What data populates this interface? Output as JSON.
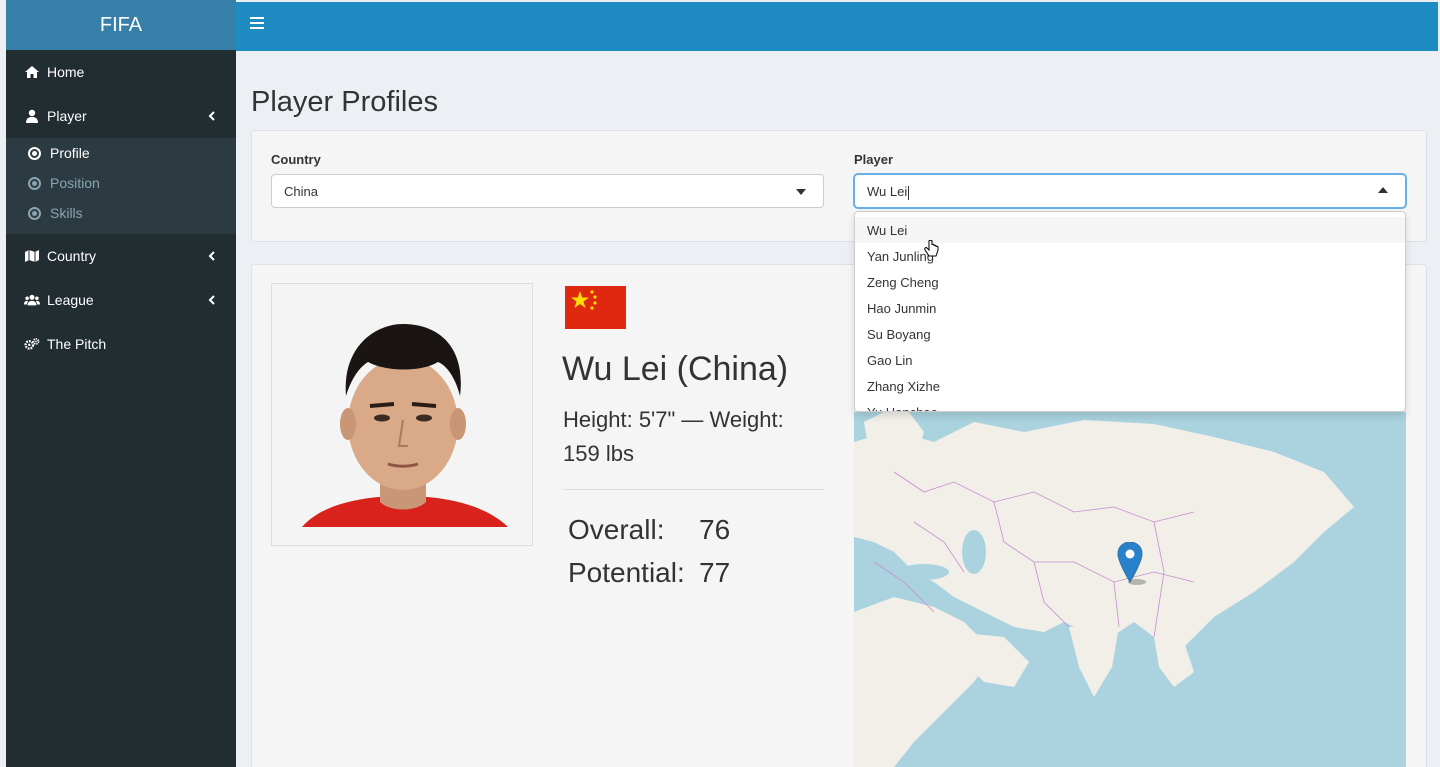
{
  "app": {
    "brand": "FIFA"
  },
  "sidebar": {
    "items": [
      {
        "label": "Home",
        "icon": "home-icon"
      },
      {
        "label": "Player",
        "icon": "user-icon",
        "expanded": true,
        "children": [
          {
            "label": "Profile",
            "icon": "soccer-ball-icon",
            "active": true
          },
          {
            "label": "Position",
            "icon": "soccer-ball-icon"
          },
          {
            "label": "Skills",
            "icon": "soccer-ball-icon"
          }
        ]
      },
      {
        "label": "Country",
        "icon": "map-icon"
      },
      {
        "label": "League",
        "icon": "users-icon"
      },
      {
        "label": "The Pitch",
        "icon": "gears-icon"
      }
    ]
  },
  "page": {
    "title": "Player Profiles"
  },
  "filters": {
    "country": {
      "label": "Country",
      "value": "China"
    },
    "player": {
      "label": "Player",
      "value": "Wu Lei",
      "options": [
        "Wu Lei",
        "Yan Junling",
        "Zeng Cheng",
        "Hao Junmin",
        "Su Boyang",
        "Gao Lin",
        "Zhang Xizhe",
        "Yu Hanchao"
      ]
    }
  },
  "profile": {
    "name": "Wu Lei (China)",
    "height_weight": "Height: 5'7\" — Weight: 159 lbs",
    "overall_label": "Overall:",
    "overall_value": "76",
    "potential_label": "Potential:",
    "potential_value": "77",
    "flag_country": "China"
  },
  "colors": {
    "sidebar_bg": "#222d32",
    "logo_bg": "#367fa9",
    "topbar_bg": "#1e8bc3",
    "flag_red": "#de2910",
    "flag_yellow": "#ffde00",
    "map_marker": "#2a81cb"
  }
}
